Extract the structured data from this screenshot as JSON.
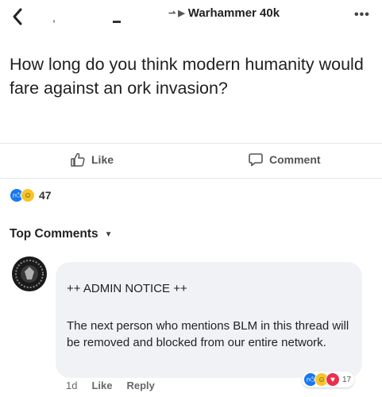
{
  "topbar": {
    "group_name": "Warhammer 40k"
  },
  "post": {
    "question": "How long do you think modern humanity would fare against an ork invasion?",
    "like_label": "Like",
    "comment_label": "Comment",
    "reaction_count": "47"
  },
  "comments_header": {
    "label": "Top Comments"
  },
  "comment": {
    "title": "++ ADMIN NOTICE ++",
    "body": "The next person who mentions BLM in this thread will be removed and blocked from our entire network.",
    "time": "1d",
    "like_label": "Like",
    "reply_label": "Reply",
    "reaction_count": "17"
  },
  "colors": {
    "like_blue": "#1877f2",
    "haha_yellow": "#f7c52b",
    "love_red": "#e8304d",
    "bubble_bg": "#f0f2f5"
  }
}
